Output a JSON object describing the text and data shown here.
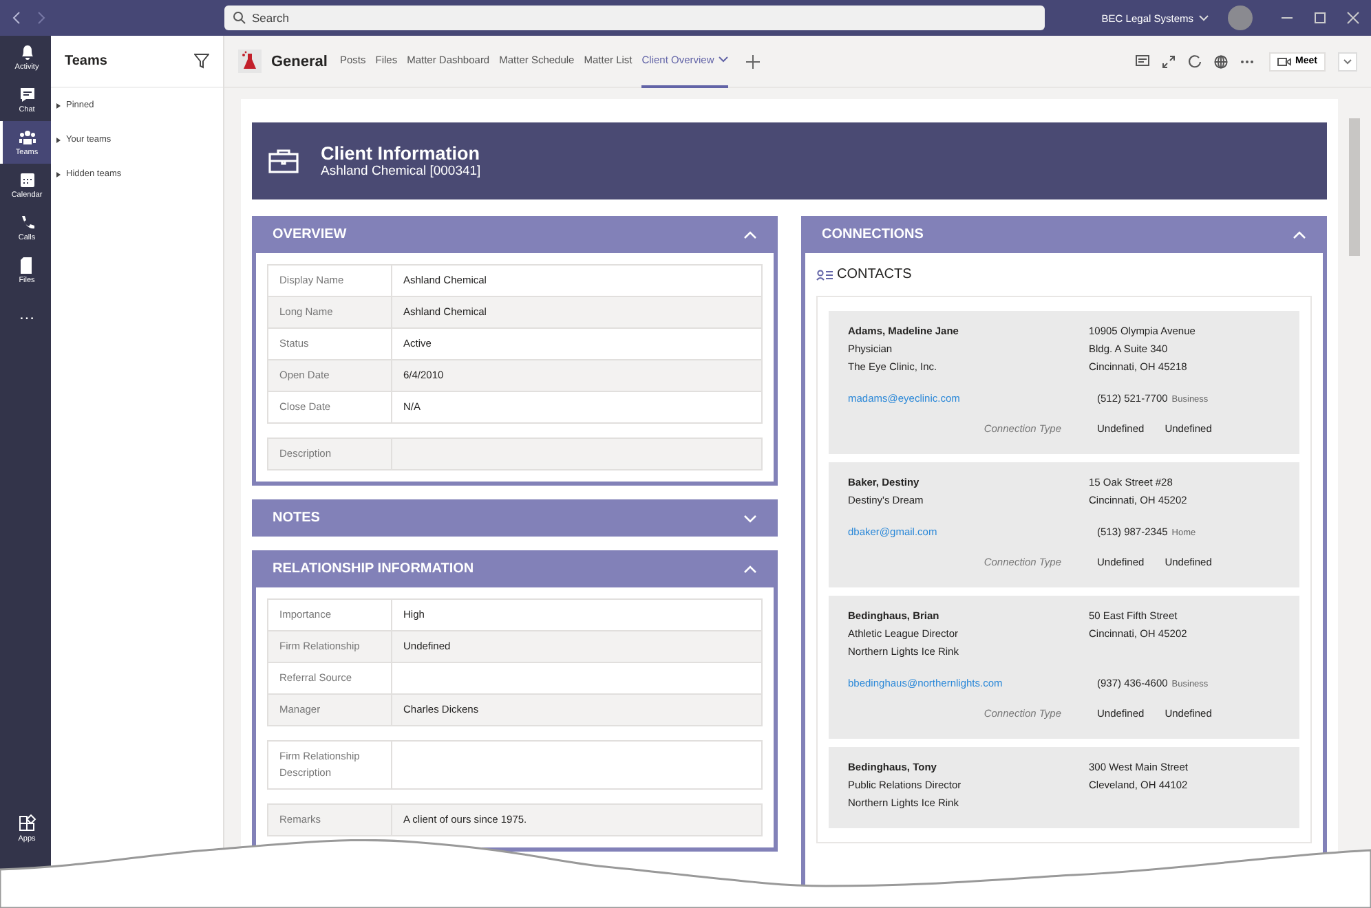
{
  "titlebar": {
    "search": {
      "placeholder": "Search"
    },
    "org": "BEC Legal Systems"
  },
  "rail": [
    {
      "label": "Activity",
      "selected": false
    },
    {
      "label": "Chat",
      "selected": false
    },
    {
      "label": "Teams",
      "selected": true
    },
    {
      "label": "Calendar",
      "selected": false
    },
    {
      "label": "Calls",
      "selected": false
    },
    {
      "label": "Files",
      "selected": false
    },
    {
      "label": "…",
      "selected": false
    }
  ],
  "rail_bottom": {
    "label": "Apps"
  },
  "teams_panel": {
    "title": "Teams",
    "groups": [
      {
        "label": "Pinned",
        "expanded": false
      },
      {
        "label": "Your teams",
        "expanded": false
      },
      {
        "label": "Hidden teams",
        "expanded": false
      }
    ]
  },
  "channel": {
    "name": "General",
    "tabs": [
      {
        "label": "Posts",
        "selected": false
      },
      {
        "label": "Files",
        "selected": false
      },
      {
        "label": "Matter Dashboard",
        "selected": false
      },
      {
        "label": "Matter Schedule",
        "selected": false
      },
      {
        "label": "Matter List",
        "selected": false
      },
      {
        "label": "Client Overview",
        "selected": true
      }
    ],
    "meet": "Meet"
  },
  "banner": {
    "title": "Client Information",
    "subtitle": "Ashland Chemical [000341]"
  },
  "sections": [
    {
      "title": "OVERVIEW",
      "expanded": true,
      "groups": [
        [
          {
            "label": "Display Name",
            "value": "Ashland Chemical"
          },
          {
            "label": "Long Name",
            "value": "Ashland Chemical"
          },
          {
            "label": "Status",
            "value": "Active"
          },
          {
            "label": "Open Date",
            "value": "6/4/2010"
          },
          {
            "label": "Close Date",
            "value": "N/A"
          }
        ],
        [
          {
            "label": "Description"
          }
        ]
      ]
    },
    {
      "title": "NOTES",
      "expanded": false
    },
    {
      "title": "RELATIONSHIP INFORMATION",
      "expanded": true,
      "groups": [
        [
          {
            "label": "Importance",
            "value": "High"
          },
          {
            "label": "Firm Relationship",
            "value": "Undefined"
          },
          {
            "label": "Referral Source"
          },
          {
            "label": "Manager",
            "value": "Charles Dickens"
          }
        ],
        [
          {
            "label": "Firm Relationship Description"
          }
        ],
        [
          {
            "label": "Remarks",
            "value": "A client of ours since 1975."
          }
        ]
      ]
    }
  ],
  "connections": {
    "title": "CONNECTIONS",
    "expanded": true,
    "subtitle": "CONTACTS",
    "contacts": [
      {
        "name": "Adams, Madeline Jane",
        "details": [
          "Physician",
          "The Eye Clinic, Inc."
        ],
        "address": [
          "10905 Olympia Avenue",
          "Bldg. A Suite 340",
          "Cincinnati, OH 45218"
        ],
        "email": "madams@eyeclinic.com",
        "phone": "(512) 521-7700",
        "phone_type": "Business",
        "connection_label": "Connection Type",
        "connection": [
          "Undefined",
          "Undefined"
        ]
      },
      {
        "name": "Baker, Destiny",
        "details": [
          "Destiny's Dream"
        ],
        "address": [
          "15 Oak Street #28",
          "Cincinnati, OH 45202"
        ],
        "email": "dbaker@gmail.com",
        "phone": "(513) 987-2345",
        "phone_type": "Home",
        "connection_label": "Connection Type",
        "connection": [
          "Undefined",
          "Undefined"
        ]
      },
      {
        "name": "Bedinghaus, Brian",
        "details": [
          "Athletic League Director",
          "Northern Lights Ice Rink"
        ],
        "address": [
          "50 East Fifth Street",
          "Cincinnati, OH 45202"
        ],
        "email": "bbedinghaus@northernlights.com",
        "phone": "(937) 436-4600",
        "phone_type": "Business",
        "connection_label": "Connection Type",
        "connection": [
          "Undefined",
          "Undefined"
        ]
      },
      {
        "name": "Bedinghaus, Tony",
        "details": [
          "Public Relations Director",
          "Northern Lights Ice Rink"
        ],
        "address": [
          "300 West Main Street",
          "Cleveland, OH 44102"
        ]
      }
    ]
  }
}
